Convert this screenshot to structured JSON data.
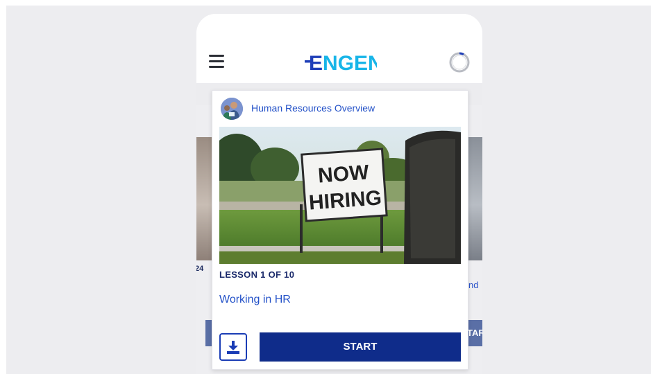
{
  "app": {
    "logo_text": "ENGEN",
    "logo_colors": {
      "accent": "#1f3fb8",
      "text": "#18b5e8"
    }
  },
  "header": {
    "menu_icon": "hamburger-menu-icon",
    "progress_icon": "progress-ring-icon"
  },
  "side_cards": {
    "left_fragment": "24",
    "right_fragment": "nd",
    "right_button_fragment": "TAR"
  },
  "card": {
    "course_title": "Human Resources Overview",
    "image_sign_text": [
      "NOW",
      "HIRING"
    ],
    "lesson_count": "LESSON 1 OF 10",
    "lesson_title": "Working in HR",
    "download_icon": "download-icon",
    "start_label": "START"
  },
  "colors": {
    "primary_button": "#0f2c8a",
    "link": "#2452c8",
    "heading": "#1b2a6b",
    "background": "#ededf0"
  }
}
